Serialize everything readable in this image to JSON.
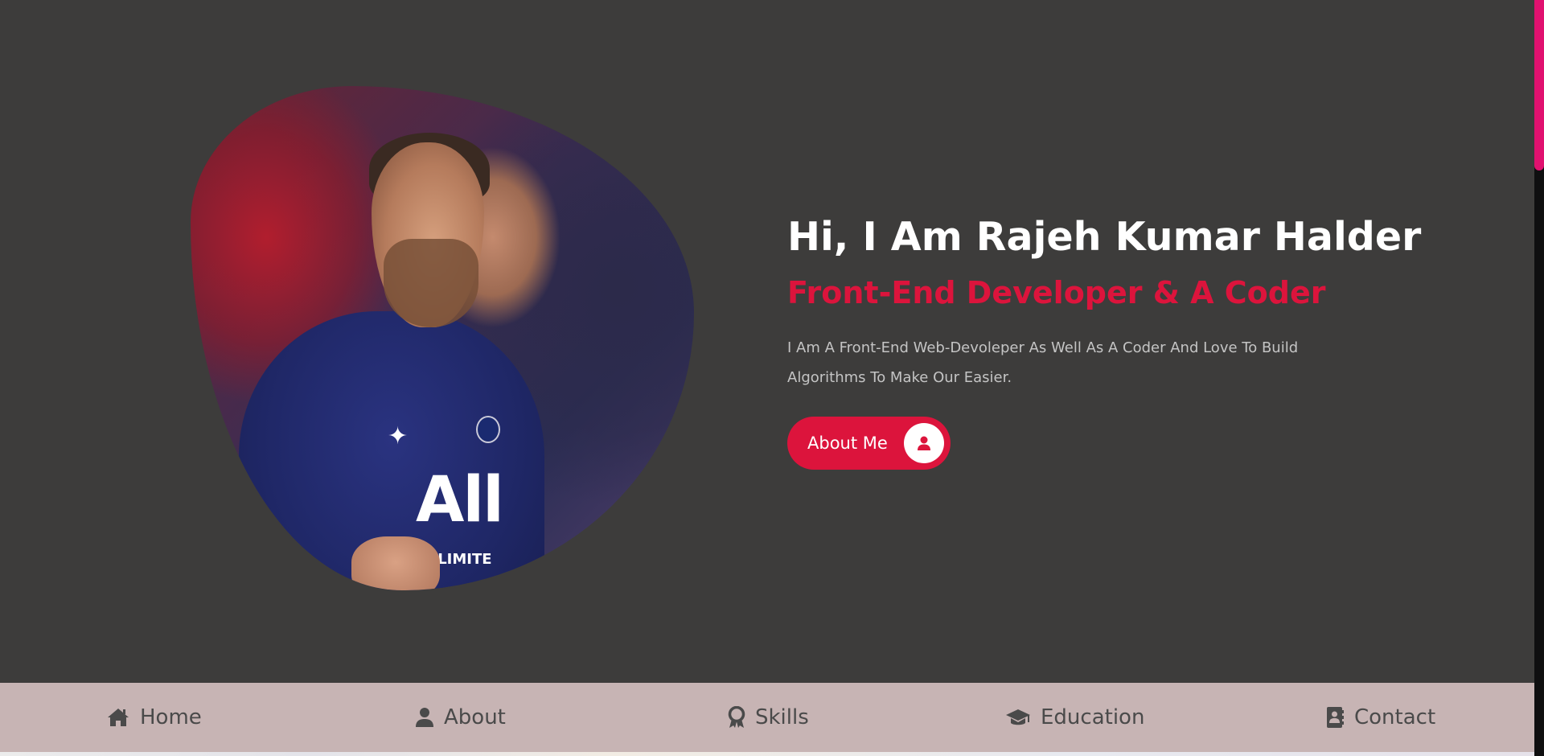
{
  "hero": {
    "title": "Hi, I Am Rajeh Kumar Halder",
    "subtitle": "Front-End Developer & A Coder",
    "description": "I Am A Front-End Web-Devoleper As Well As A Coder And Love To Build Algorithms To Make Our Easier.",
    "button_label": "About Me",
    "button_icon": "user-icon",
    "image_shirt_text": "All",
    "image_shirt_subtext": "IVE LIMITE"
  },
  "nav": {
    "items": [
      {
        "label": "Home",
        "icon": "home-icon"
      },
      {
        "label": "About",
        "icon": "user-icon"
      },
      {
        "label": "Skills",
        "icon": "award-icon"
      },
      {
        "label": "Education",
        "icon": "graduation-cap-icon"
      },
      {
        "label": "Contact",
        "icon": "address-book-icon"
      }
    ]
  },
  "colors": {
    "background": "#3d3c3b",
    "accent": "#dc143c",
    "nav_background": "#c7b4b4",
    "scrollbar_thumb": "#e0116f"
  }
}
